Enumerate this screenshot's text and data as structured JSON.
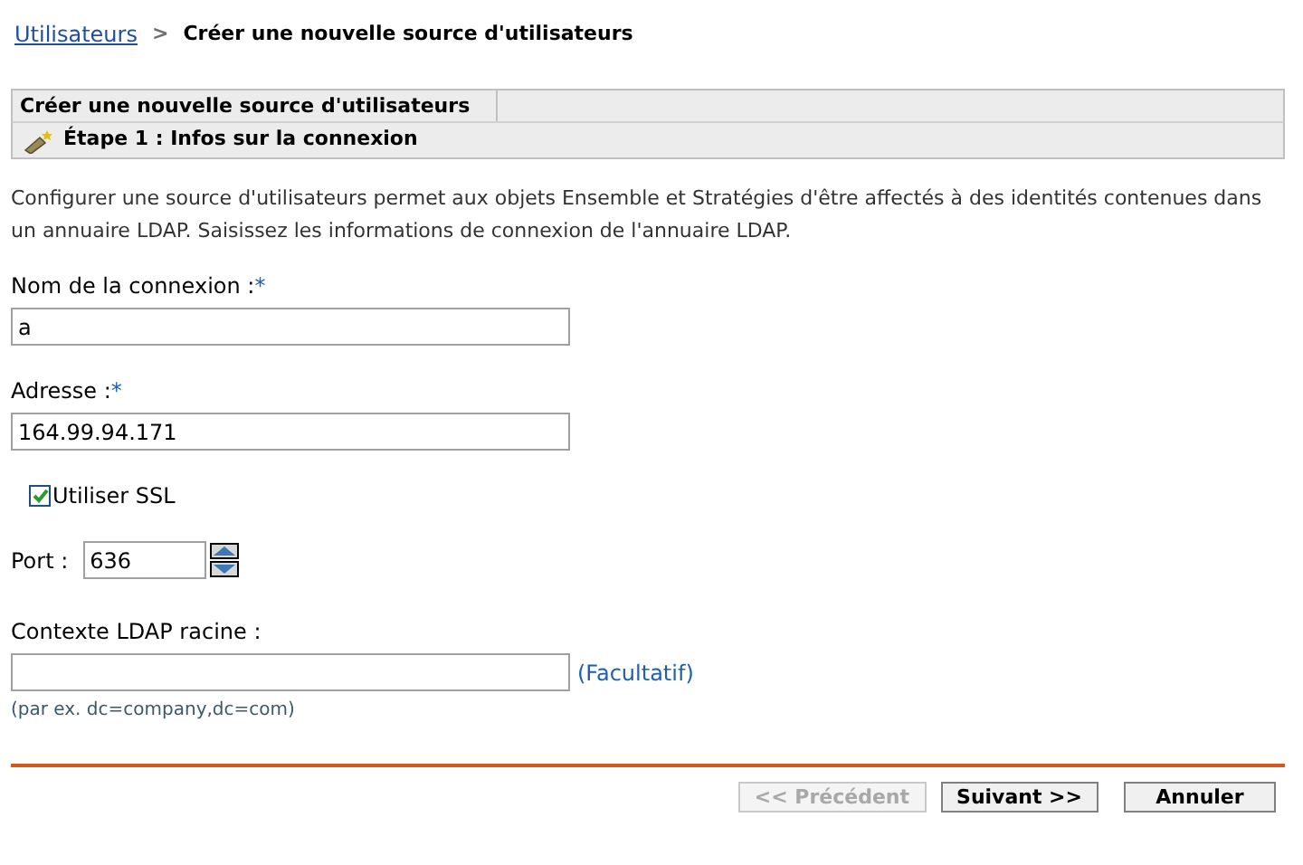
{
  "breadcrumb": {
    "link": "Utilisateurs",
    "separator": ">",
    "current": "Créer une nouvelle source d'utilisateurs"
  },
  "panel": {
    "title": "Créer une nouvelle source d'utilisateurs",
    "step": "Étape 1 : Infos sur la connexion"
  },
  "description": "Configurer une source d'utilisateurs permet aux objets Ensemble et Stratégies d'être affectés à des identités contenues dans un annuaire LDAP. Saisissez les informations de connexion de l'annuaire LDAP.",
  "fields": [
    {
      "kind": "text",
      "label": "Nom de la connexion :",
      "required_mark": "*",
      "value": "a"
    },
    {
      "kind": "text",
      "label": "Adresse :",
      "required_mark": "*",
      "value": "164.99.94.171"
    },
    {
      "kind": "checkbox",
      "label": "Utiliser SSL",
      "checked": true
    },
    {
      "kind": "spinner",
      "label": "Port :",
      "value": "636"
    },
    {
      "kind": "optional",
      "label": "Contexte LDAP racine :",
      "note": "(Facultatif)",
      "hint": "(par ex. dc=company,dc=com)"
    }
  ],
  "buttons": [
    {
      "label": "<< Précédent",
      "disabled": true
    },
    {
      "label": "Suivant >>",
      "disabled": false
    },
    {
      "label": "Annuler",
      "disabled": false
    }
  ]
}
